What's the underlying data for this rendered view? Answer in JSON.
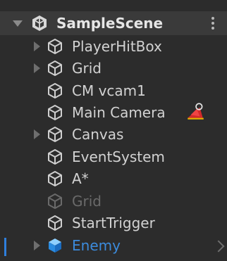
{
  "hierarchy": {
    "scene": {
      "name": "SampleScene",
      "icon": "unity-scene-icon",
      "menu_icon": "more-vertical-icon"
    },
    "items": [
      {
        "name": "PlayerHitBox",
        "icon": "cube-outline-icon",
        "expandable": true
      },
      {
        "name": "Grid",
        "icon": "cube-outline-icon",
        "expandable": true
      },
      {
        "name": "CM vcam1",
        "icon": "cube-outline-icon",
        "expandable": false
      },
      {
        "name": "Main Camera",
        "icon": "cube-outline-icon",
        "expandable": false,
        "badge": "cinemachine-brain-icon"
      },
      {
        "name": "Canvas",
        "icon": "cube-outline-icon",
        "expandable": true
      },
      {
        "name": "EventSystem",
        "icon": "cube-outline-icon",
        "expandable": false
      },
      {
        "name": "A*",
        "icon": "cube-outline-icon",
        "expandable": false
      },
      {
        "name": "Grid",
        "icon": "cube-outline-icon",
        "expandable": false,
        "disabled": true
      },
      {
        "name": "StartTrigger",
        "icon": "cube-outline-icon",
        "expandable": false
      },
      {
        "name": "Enemy",
        "icon": "prefab-cube-icon",
        "expandable": true,
        "prefab": true
      }
    ]
  },
  "colors": {
    "background": "#2c2c2c",
    "text": "#d2d2d2",
    "disabled_text": "#6a6a6a",
    "prefab_text": "#3c8bdc",
    "selection_bar": "#2f7fdc",
    "badge_red": "#d42a2a"
  }
}
